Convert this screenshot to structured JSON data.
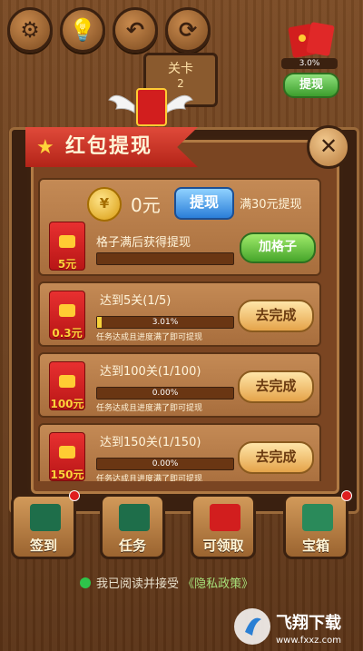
{
  "top_bar": {
    "level_label": "关卡",
    "level_number": "2",
    "progress_text": "3.0%",
    "withdraw_label": "提现"
  },
  "modal": {
    "title": "红包提现",
    "close_symbol": "✕",
    "balance": {
      "amount": "0元",
      "withdraw_button": "提现",
      "threshold_text": "满30元提现"
    },
    "grid": {
      "envelope_amount": "5元",
      "label": "格子满后获得提现",
      "progress_percent": 0,
      "add_button": "加格子"
    },
    "tasks": [
      {
        "envelope_amount": "0.3元",
        "title": "达到5关(1/5)",
        "progress_text": "3.01%",
        "progress_percent": 3.01,
        "note": "任务达成且进度满了即可提现",
        "button": "去完成"
      },
      {
        "envelope_amount": "100元",
        "title": "达到100关(1/100)",
        "progress_text": "0.00%",
        "progress_percent": 0,
        "note": "任务达成且进度满了即可提现",
        "button": "去完成"
      },
      {
        "envelope_amount": "150元",
        "title": "达到150关(1/150)",
        "progress_text": "0.00%",
        "progress_percent": 0,
        "note": "任务达成且进度满了即可提现",
        "button": "去完成"
      }
    ]
  },
  "bottom_nav": [
    {
      "label": "签到",
      "icon": "calendar-check-icon"
    },
    {
      "label": "任务",
      "icon": "list-icon"
    },
    {
      "label": "可领取",
      "icon": "red-envelope-icon"
    },
    {
      "label": "宝箱",
      "icon": "treasure-chest-icon"
    }
  ],
  "agreement": {
    "text": "我已阅读并接受",
    "link": "《隐私政策》"
  },
  "watermark": {
    "brand": "飞翔下载",
    "url": "www.fxxz.com"
  },
  "colors": {
    "accent_red": "#d21e1e",
    "accent_gold": "#ffd23a",
    "wood": "#7a4522"
  }
}
